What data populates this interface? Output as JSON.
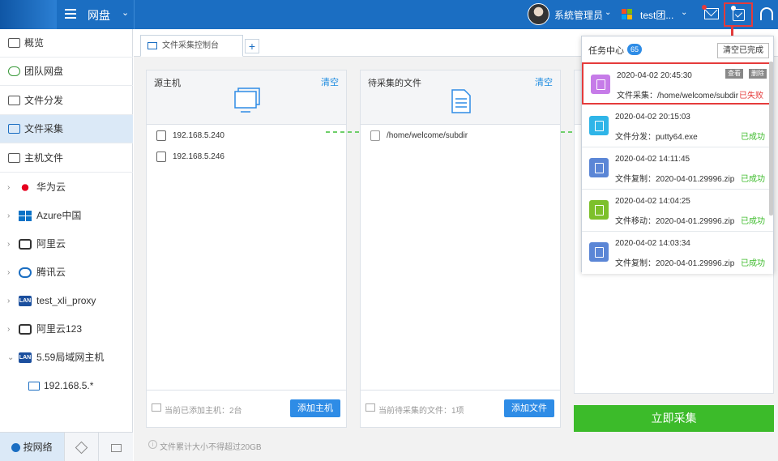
{
  "topbar": {
    "app_title": "网盘",
    "user_name": "系統管理员",
    "team_name": "test团...",
    "brand_color": "#1b6ec2"
  },
  "sidebar": {
    "items": [
      {
        "label": "概览",
        "icon": "overview-icon"
      },
      {
        "label": "团队网盘",
        "icon": "cloud-icon"
      },
      {
        "label": "文件分发",
        "icon": "distribute-icon"
      },
      {
        "label": "文件采集",
        "icon": "collect-icon",
        "active": true
      },
      {
        "label": "主机文件",
        "icon": "host-file-icon"
      }
    ],
    "tree": [
      {
        "label": "华为云",
        "icon": "huawei-icon"
      },
      {
        "label": "Azure中国",
        "icon": "azure-icon"
      },
      {
        "label": "阿里云",
        "icon": "aliyun-icon"
      },
      {
        "label": "腾讯云",
        "icon": "tencent-cloud-icon"
      },
      {
        "label": "test_xli_proxy",
        "icon": "lan-icon"
      },
      {
        "label": "阿里云123",
        "icon": "aliyun-icon"
      },
      {
        "label": "5.59局域网主机",
        "icon": "lan-icon",
        "expanded": true
      },
      {
        "label": "192.168.5.*",
        "icon": "host-icon"
      }
    ],
    "lan_badge": "LAN",
    "bottom_tabs": [
      {
        "label": "按网络",
        "icon": "network-icon"
      },
      {
        "label": "",
        "icon": "tag-icon"
      },
      {
        "label": "",
        "icon": "folder-icon"
      }
    ]
  },
  "main": {
    "tab_label": "文件采集控制台",
    "source_panel": {
      "title": "源主机",
      "clear": "清空",
      "hosts": [
        "192.168.5.240",
        "192.168.5.246"
      ],
      "footer": "当前已添加主机：2台",
      "add_button": "添加主机"
    },
    "files_panel": {
      "title": "待采集的文件",
      "clear": "清空",
      "files": [
        "/home/welcome/subdir"
      ],
      "footer": "当前待采集的文件：1项",
      "add_button": "添加文件"
    },
    "collect_button": "立即采集",
    "note": "文件累计大小不得超过20GB"
  },
  "task_center": {
    "title": "任务中心",
    "count": "65",
    "clear_done": "清空已完成",
    "view_label": "查看",
    "delete_label": "删除",
    "tasks": [
      {
        "time": "2020-04-02 20:45:30",
        "desc": "文件采集：/home/welcome/subdir",
        "status": "已失败",
        "status_color": "#e53b3b",
        "icon_color": "#c67be8"
      },
      {
        "time": "2020-04-02 20:15:03",
        "desc": "文件分发：putty64.exe",
        "status": "已成功",
        "status_color": "#3cbb2a",
        "icon_color": "#2fb5e8"
      },
      {
        "time": "2020-04-02 14:11:45",
        "desc": "文件复制：2020-04-01.29996.zip",
        "status": "已成功",
        "status_color": "#3cbb2a",
        "icon_color": "#5b86d6"
      },
      {
        "time": "2020-04-02 14:04:25",
        "desc": "文件移动：2020-04-01.29996.zip",
        "status": "已成功",
        "status_color": "#3cbb2a",
        "icon_color": "#7dc02b"
      },
      {
        "time": "2020-04-02 14:03:34",
        "desc": "文件复制：2020-04-01.29996.zip",
        "status": "已成功",
        "status_color": "#3cbb2a",
        "icon_color": "#5b86d6"
      }
    ]
  }
}
